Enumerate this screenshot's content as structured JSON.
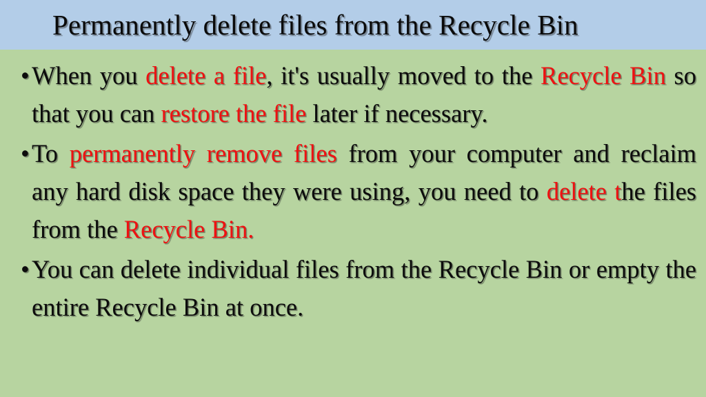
{
  "slide": {
    "title": "Permanently delete files from the Recycle Bin",
    "banner_color": "#b3cde8",
    "background_color": "#b7d4a0",
    "accent_color": "#ee1111",
    "text_color": "#0c0c0c",
    "bullets": [
      {
        "id": "bullet-1",
        "segments": [
          {
            "text": "When you ",
            "color": "black"
          },
          {
            "text": "delete a file",
            "color": "red"
          },
          {
            "text": ", it's usually moved to the ",
            "color": "black"
          },
          {
            "text": "Recycle Bin",
            "color": "red"
          },
          {
            "text": " so that you can ",
            "color": "black"
          },
          {
            "text": "restore the file",
            "color": "red"
          },
          {
            "text": " later if necessary.",
            "color": "black"
          }
        ],
        "plain": "When you delete a file, it's usually moved to the Recycle Bin so that you can restore the file later if necessary."
      },
      {
        "id": "bullet-2",
        "segments": [
          {
            "text": "To ",
            "color": "black"
          },
          {
            "text": "permanently remove files",
            "color": "red"
          },
          {
            "text": " from your computer and reclaim any hard disk space they were using, you need to ",
            "color": "black"
          },
          {
            "text": "delete t",
            "color": "red"
          },
          {
            "text": "he files from the ",
            "color": "black"
          },
          {
            "text": "Recycle Bin.",
            "color": "red"
          }
        ],
        "plain": "To permanently remove files from your computer and reclaim any hard disk space they were using, you need to delete the files from the Recycle Bin."
      },
      {
        "id": "bullet-3",
        "segments": [
          {
            "text": "You can delete individual files from the Recycle Bin or empty the entire Recycle Bin at once.",
            "color": "black"
          }
        ],
        "plain": "You can delete individual files from the Recycle Bin or empty the entire Recycle Bin at once."
      }
    ]
  },
  "b1": {
    "s0": "When you ",
    "s1": "delete a file",
    "s2": ", it's usually moved to the ",
    "s3": "Recycle Bin",
    "s4": " so that you can ",
    "s5": "restore the file",
    "s6": " later if necessary."
  },
  "b2": {
    "s0": "To ",
    "s1": "permanently remove files",
    "s2": " from your computer and reclaim any hard disk space they were using, you need to ",
    "s3": "delete t",
    "s4": "he files from the ",
    "s5": "Recycle Bin."
  },
  "b3": {
    "s0": "You can delete individual files from the Recycle Bin or empty the entire Recycle Bin at once."
  }
}
